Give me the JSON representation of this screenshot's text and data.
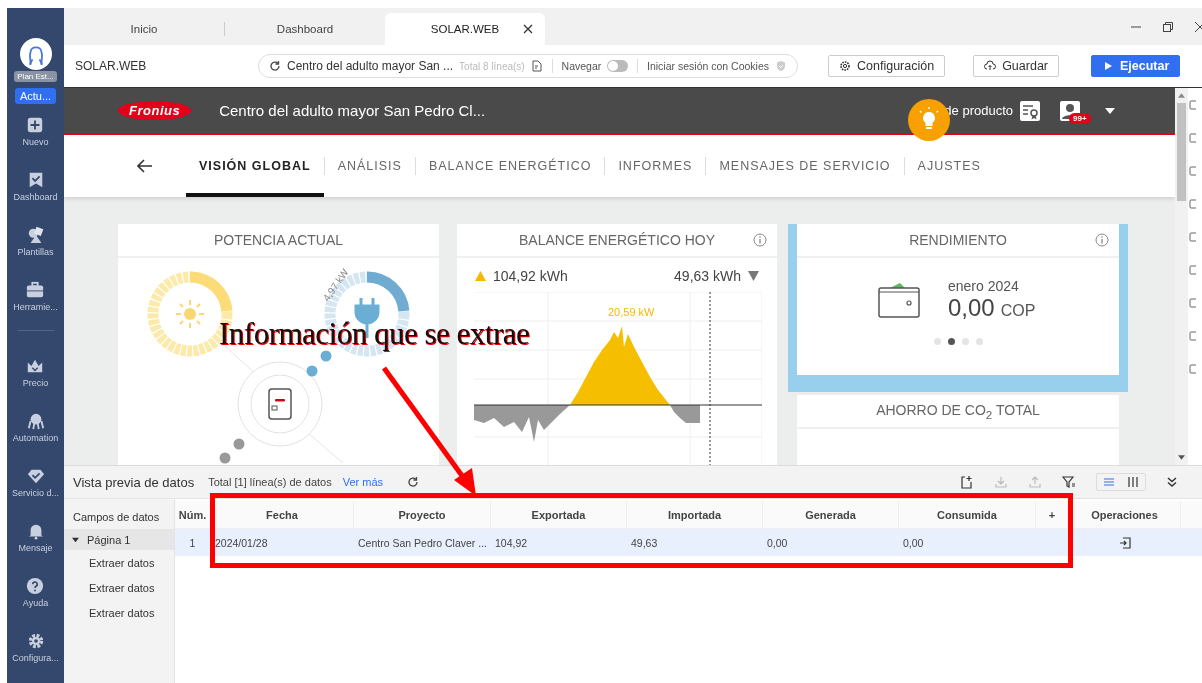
{
  "sidebar": {
    "profile_label": "Plan Est...",
    "plan_button": "Actu...",
    "groups": [
      [
        {
          "label": "Nuevo",
          "kind": "plus"
        },
        {
          "label": "Dashboard",
          "kind": "bookmark"
        },
        {
          "label": "Plantillas",
          "kind": "shapes"
        },
        {
          "label": "Herramie...",
          "kind": "toolbox"
        }
      ],
      [
        {
          "label": "Precio",
          "kind": "crown"
        },
        {
          "label": "Automation",
          "kind": "robot"
        },
        {
          "label": "Servicio d...",
          "kind": "diamond"
        },
        {
          "label": "Mensaje",
          "kind": "bell"
        },
        {
          "label": "Ayuda",
          "kind": "help"
        },
        {
          "label": "Configura...",
          "kind": "gear"
        }
      ]
    ]
  },
  "tabs": [
    {
      "label": "Inicio",
      "selected": false
    },
    {
      "label": "Dashboard",
      "selected": false
    },
    {
      "label": "SOLAR.WEB",
      "selected": true
    }
  ],
  "address_bar": {
    "site_label": "SOLAR.WEB",
    "url": "Centro del adulto mayor San ...",
    "line_count": "Total 8 línea(s)",
    "navigate": {
      "label": "Navegar",
      "on": false
    },
    "cookies_label": "Iniciar sesión con Cookies"
  },
  "buttons": [
    {
      "label": "Configuración",
      "kind": "settings",
      "primary": false
    },
    {
      "label": "Guardar",
      "kind": "save",
      "primary": false
    },
    {
      "label": "Ejecutar",
      "kind": "run",
      "primary": true
    }
  ],
  "page": {
    "header": {
      "logo": "Fronius",
      "title": "Centro del adulto mayor San Pedro Cl...",
      "product_label": "de producto",
      "notification_count": "99+"
    },
    "nav": [
      {
        "label": "VISIÓN GLOBAL",
        "selected": true
      },
      {
        "label": "ANÁLISIS",
        "selected": false
      },
      {
        "label": "BALANCE ENERGÉTICO",
        "selected": false
      },
      {
        "label": "INFORMES",
        "selected": false
      },
      {
        "label": "MENSAJES DE SERVICIO",
        "selected": false
      },
      {
        "label": "AJUSTES",
        "selected": false
      }
    ],
    "power": {
      "title": "POTENCIA ACTUAL",
      "grid_power": "4,97 kW"
    },
    "balance": {
      "title": "BALANCE ENERGÉTICO HOY",
      "produced": "104,92 kWh",
      "consumed": "49,63 kWh",
      "peak_label": "20,59 kW"
    },
    "yield": {
      "title": "RENDIMIENTO",
      "period": "enero 2024",
      "amount": "0,00",
      "currency": "COP",
      "pager": [
        {
          "selected": false
        },
        {
          "selected": true
        },
        {
          "selected": false
        },
        {
          "selected": false
        }
      ]
    },
    "co2": {
      "title": "AHORRO DE CO$_{2}$ TOTAL"
    }
  },
  "preview": {
    "title": "Vista previa de datos",
    "total": "Total [1] línea(s) de datos",
    "more_link": "Ver más",
    "view_modes": [
      {
        "kind": "list",
        "selected": true
      },
      {
        "kind": "columns",
        "selected": false
      }
    ],
    "tree": {
      "heading": "Campos de datos",
      "nodes": [
        {
          "label": "Página 1",
          "expanded": true,
          "selected": true,
          "children": [
            {
              "label": "Extraer datos"
            },
            {
              "label": "Extraer datos"
            },
            {
              "label": "Extraer datos"
            }
          ]
        }
      ]
    },
    "table": {
      "columns": [
        "Núm.",
        "Fecha",
        "Proyecto",
        "Exportada",
        "Importada",
        "Generada",
        "Consumida"
      ],
      "add_column": "+",
      "operations": "Operaciones",
      "rows": [
        {
          "selected": true,
          "cells": [
            "1",
            "2024/01/28",
            "Centro San Pedro Claver ...",
            "104,92",
            "49,63",
            "0,00",
            "0,00"
          ]
        }
      ]
    }
  },
  "annotation": {
    "label": "Información que se extrae"
  }
}
